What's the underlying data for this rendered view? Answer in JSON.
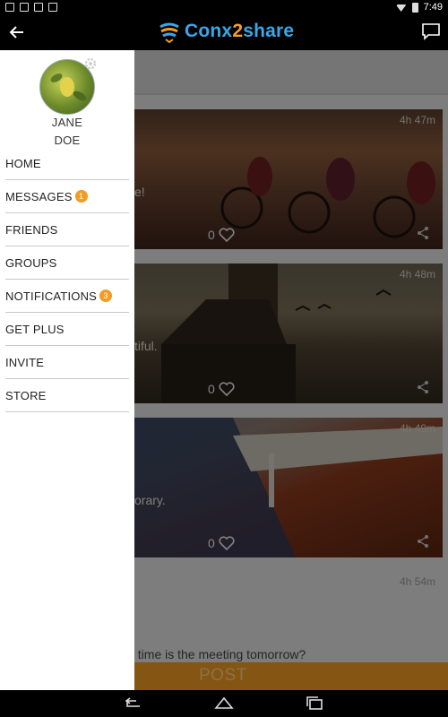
{
  "status_bar": {
    "time": "7:49"
  },
  "app_bar": {
    "logo_part1": "Conx",
    "logo_part2": "2",
    "logo_part3": "share",
    "brand_blue": "#3ba6e8",
    "brand_orange": "#f29c24"
  },
  "drawer": {
    "user_first": "JANE",
    "user_last": "DOE",
    "items": [
      {
        "label": "HOME",
        "badge": ""
      },
      {
        "label": "MESSAGES",
        "badge": "1"
      },
      {
        "label": "FRIENDS",
        "badge": ""
      },
      {
        "label": "GROUPS",
        "badge": ""
      },
      {
        "label": "NOTIFICATIONS",
        "badge": "3"
      },
      {
        "label": "GET PLUS",
        "badge": ""
      },
      {
        "label": "INVITE",
        "badge": ""
      },
      {
        "label": "STORE",
        "badge": ""
      }
    ]
  },
  "feed": {
    "posts": [
      {
        "time": "4h 47m",
        "text": "e!",
        "likes": "0"
      },
      {
        "time": "4h 48m",
        "text": "tiful.",
        "likes": "0"
      },
      {
        "time": "4h 49m",
        "text": "orary.",
        "likes": "0"
      }
    ],
    "post4": {
      "time": "4h 54m",
      "text": "t time is the meeting tomorrow?"
    },
    "post_button": "POST"
  }
}
